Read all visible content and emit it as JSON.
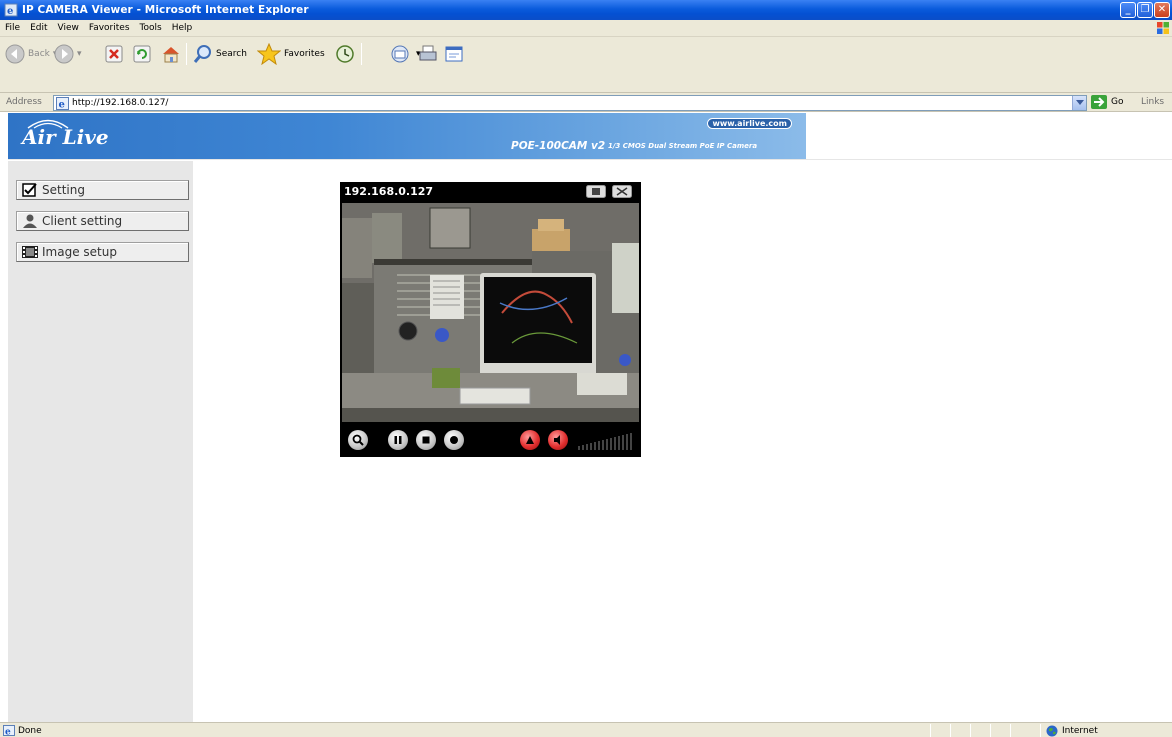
{
  "window": {
    "title": "IP CAMERA Viewer - Microsoft Internet Explorer"
  },
  "menu": [
    "File",
    "Edit",
    "View",
    "Favorites",
    "Tools",
    "Help"
  ],
  "toolbar": {
    "back": "Back",
    "search": "Search",
    "favorites": "Favorites"
  },
  "address": {
    "label": "Address",
    "url": "http://192.168.0.127/",
    "go": "Go",
    "links": "Links"
  },
  "banner": {
    "logo": "Air Live",
    "site": "www.airlive.com",
    "model": "POE-100CAM v2",
    "model_desc": "1/3 CMOS Dual Stream PoE IP Camera"
  },
  "sidebar": {
    "items": [
      {
        "label": "Setting",
        "icon": "checkbox-icon"
      },
      {
        "label": "Client setting",
        "icon": "user-icon"
      },
      {
        "label": "Image setup",
        "icon": "film-icon"
      }
    ]
  },
  "viewer": {
    "ip": "192.168.0.127",
    "controls": [
      "zoom-icon",
      "pause-icon",
      "stop-icon",
      "record-icon",
      "snapshot-icon",
      "mute-icon"
    ]
  },
  "status": {
    "text": "Done",
    "zone": "Internet"
  },
  "colors": {
    "titlebar": "#0a5bdc",
    "banner": "#3f86d4",
    "chrome": "#ece9d8"
  }
}
